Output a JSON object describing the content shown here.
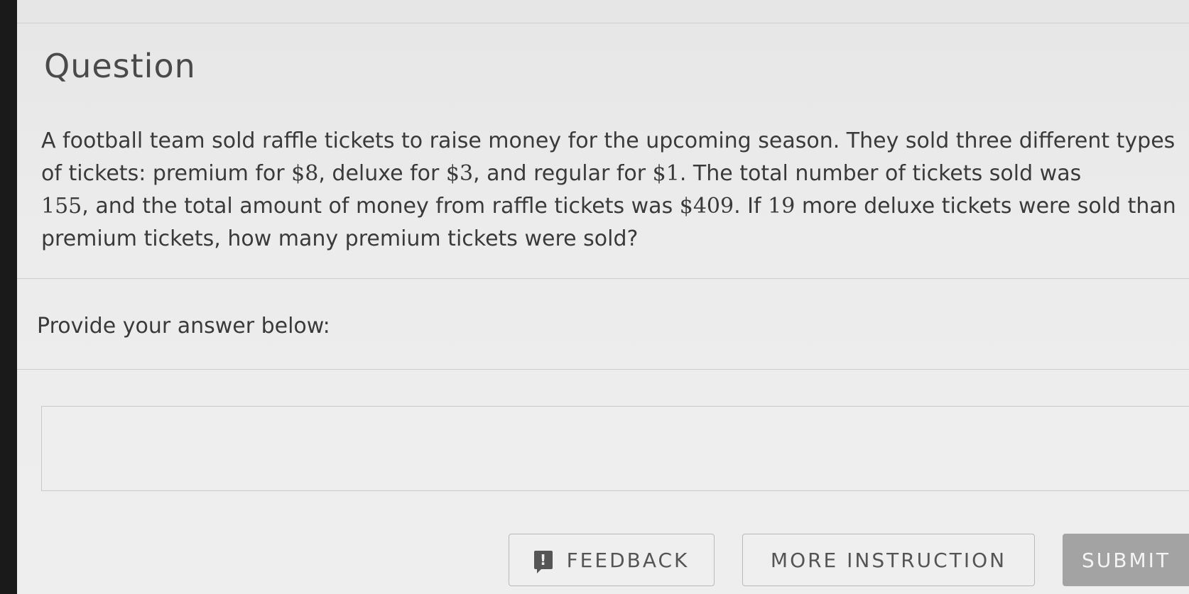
{
  "header": {
    "title": "Question"
  },
  "question": {
    "part1": "A football team sold raffle tickets to raise money for the upcoming season. They sold three different types of tickets: premium for ",
    "price_premium": "$8",
    "part2": ", deluxe for ",
    "price_deluxe": "$3",
    "part3": ", and regular for ",
    "price_regular": "$1",
    "part4": ". The total number of tickets sold was ",
    "total_tickets": "155",
    "part5": ", and the total amount of money from raffle tickets was ",
    "total_money": "$409",
    "part6": ". If ",
    "difference": "19",
    "part7": " more deluxe tickets were sold than premium tickets, how many premium tickets were sold?"
  },
  "answer": {
    "prompt": "Provide your answer below:",
    "value": "",
    "placeholder": ""
  },
  "buttons": {
    "feedback_icon": "!",
    "feedback_label": "FEEDBACK",
    "more_instruction_label": "MORE INSTRUCTION",
    "submit_label": "SUBMIT"
  },
  "colors": {
    "background": "#ececec",
    "text": "#3a3a3a",
    "submit_disabled": "#a3a3a3"
  }
}
